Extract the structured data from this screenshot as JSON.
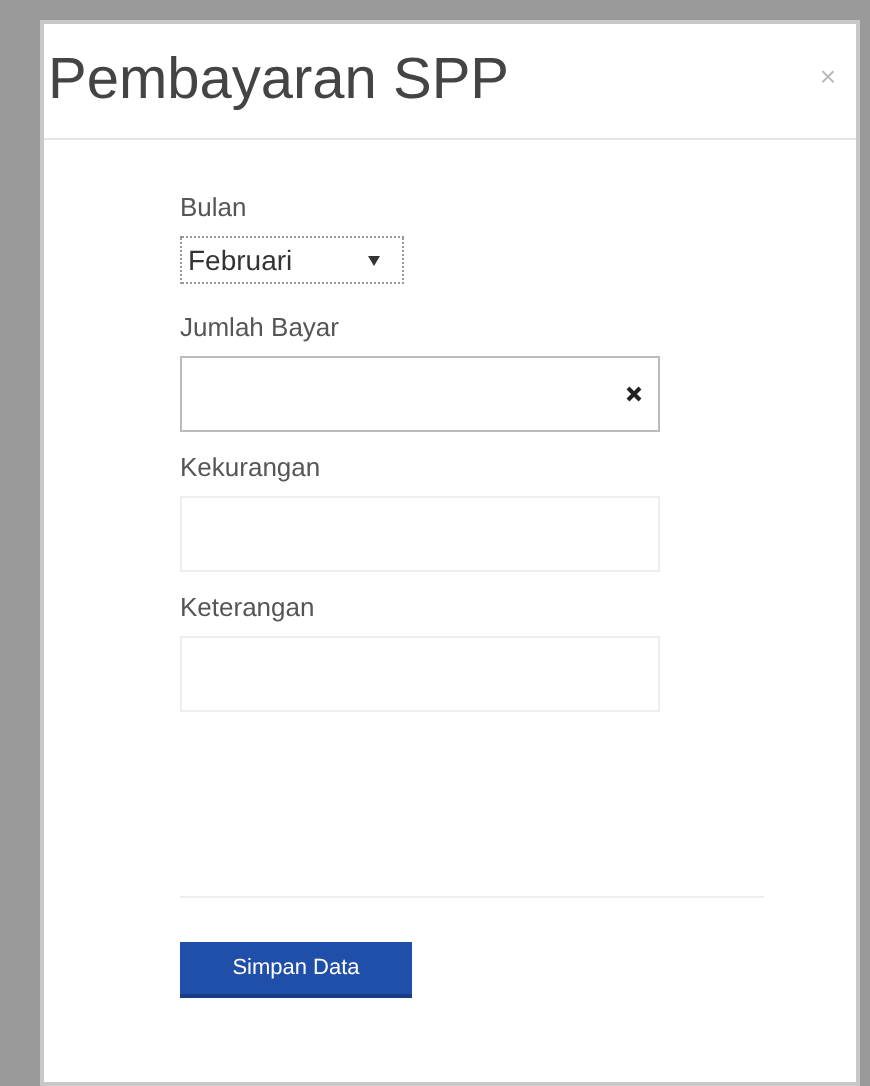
{
  "modal": {
    "title": "Pembayaran SPP",
    "close": "×"
  },
  "fields": [
    {
      "kind": "select",
      "label": "Bulan",
      "value": "Februari"
    },
    {
      "kind": "text",
      "label": "Jumlah Bayar",
      "clearable": true
    },
    {
      "kind": "text",
      "label": "Kekurangan",
      "clearable": false
    },
    {
      "kind": "text",
      "label": "Keterangan",
      "clearable": false
    }
  ],
  "submit_button": "Simpan Data"
}
